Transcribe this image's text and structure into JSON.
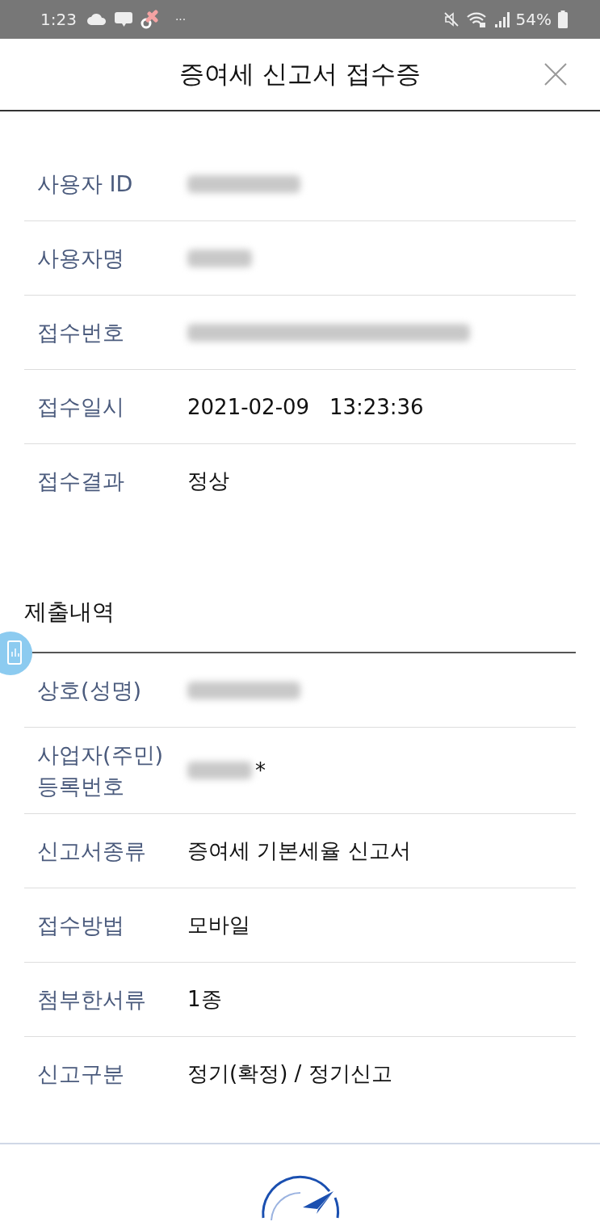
{
  "status_bar": {
    "time": "1:23",
    "more": "···",
    "battery": "54%"
  },
  "header": {
    "title": "증여세 신고서 접수증"
  },
  "receipt": [
    {
      "label": "사용자 ID",
      "kind": "redacted"
    },
    {
      "label": "사용자명",
      "kind": "redacted"
    },
    {
      "label": "접수번호",
      "kind": "redacted"
    },
    {
      "label": "접수일시",
      "kind": "text",
      "value": "2021-02-09   13:23:36"
    },
    {
      "label": "접수결과",
      "kind": "text",
      "value": "정상"
    }
  ],
  "submission": {
    "title": "제출내역",
    "rows": [
      {
        "label": "상호(성명)",
        "kind": "redacted"
      },
      {
        "label": "사업자(주민)\n등록번호",
        "kind": "redacted",
        "suffix": "*"
      },
      {
        "label": "신고서종류",
        "kind": "text",
        "value": "증여세 기본세율 신고서"
      },
      {
        "label": "접수방법",
        "kind": "text",
        "value": "모바일"
      },
      {
        "label": "첨부한서류",
        "kind": "text",
        "value": "1종"
      },
      {
        "label": "신고구분",
        "kind": "text",
        "value": "정기(확정) / 정기신고"
      }
    ]
  }
}
